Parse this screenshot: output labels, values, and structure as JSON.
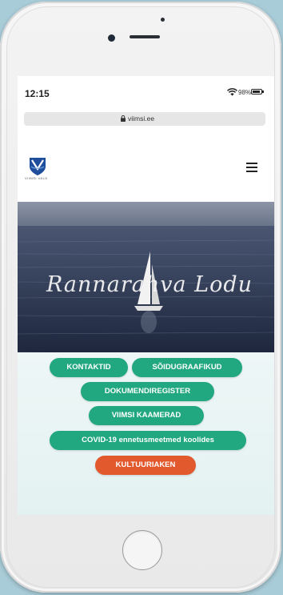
{
  "status_bar": {
    "time": "12:15",
    "battery_percent": "98%",
    "wifi_icon": "wifi-icon",
    "battery_icon": "battery-icon"
  },
  "browser": {
    "url": "viimsi.ee",
    "lock_icon": "lock-icon"
  },
  "site": {
    "logo_text": "VIIMSI VALD",
    "menu_icon": "hamburger-menu-icon"
  },
  "hero": {
    "script_text": "Rannarahva Lodu"
  },
  "buttons": {
    "kontaktid": "KONTAKTID",
    "soidugraafikud": "SÕIDUGRAAFIKUD",
    "dokumendiregister": "DOKUMENDIREGISTER",
    "viimsi_kaamerad": "VIIMSI KAAMERAD",
    "covid": "COVID-19 ennetusmeetmed koolides",
    "kultuuriaken": "KULTUURIAKEN"
  },
  "colors": {
    "button_green": "#21a880",
    "button_orange": "#e3592e",
    "hero_sea": "#2a344f"
  }
}
